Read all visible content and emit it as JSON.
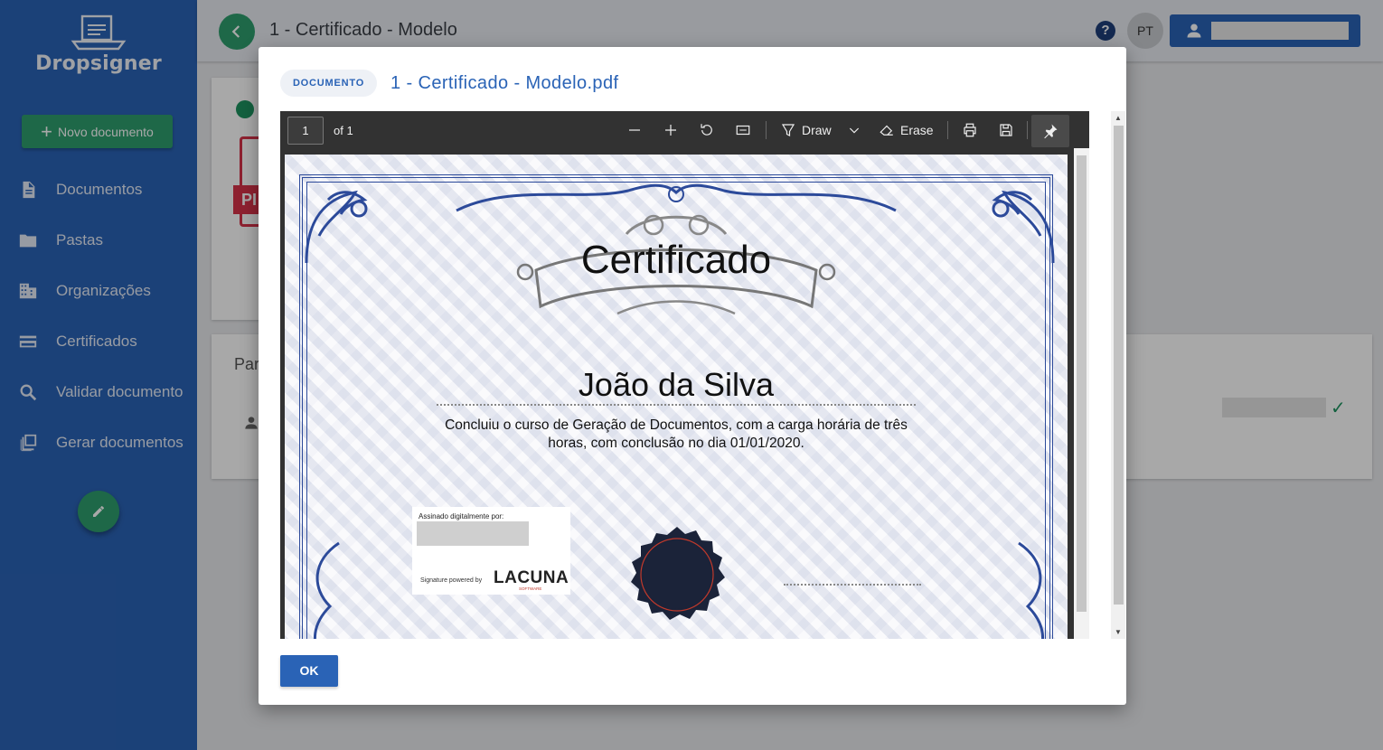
{
  "app": {
    "name": "Dropsigner",
    "new_document_label": "Novo documento"
  },
  "sidebar": {
    "items": [
      {
        "label": "Documentos",
        "icon": "document-icon"
      },
      {
        "label": "Pastas",
        "icon": "folder-icon"
      },
      {
        "label": "Organizações",
        "icon": "building-icon"
      },
      {
        "label": "Certificados",
        "icon": "card-icon"
      },
      {
        "label": "Validar documento",
        "icon": "search-icon"
      },
      {
        "label": "Gerar documentos",
        "icon": "multi-doc-icon"
      }
    ]
  },
  "header": {
    "title": "1 - Certificado - Modelo",
    "avatar_initials": "PT",
    "help_label": "?"
  },
  "background": {
    "participants_label": "Par",
    "pdf_badge": "PI"
  },
  "modal": {
    "chip_label": "DOCUMENTO",
    "title": "1 - Certificado - Modelo.pdf",
    "ok_label": "OK",
    "viewer": {
      "page_value": "1",
      "page_of": "of 1",
      "draw_label": "Draw",
      "erase_label": "Erase"
    },
    "certificate": {
      "heading": "Certificado",
      "recipient": "João da Silva",
      "description": "Concluiu o curso de Geração de Documentos, com a carga horária de três horas, com conclusão no dia 01/01/2020.",
      "signed_by_label": "Assinado digitalmente por:",
      "powered_by_label": "Signature powered by",
      "powered_brand": "LACUNA",
      "powered_brand_sub": "SOFTWARE"
    }
  },
  "colors": {
    "sidebar": "#2a63b6",
    "accent_green": "#2e9e6e",
    "primary_blue": "#2a63b6",
    "pdf_red": "#d8334a"
  }
}
